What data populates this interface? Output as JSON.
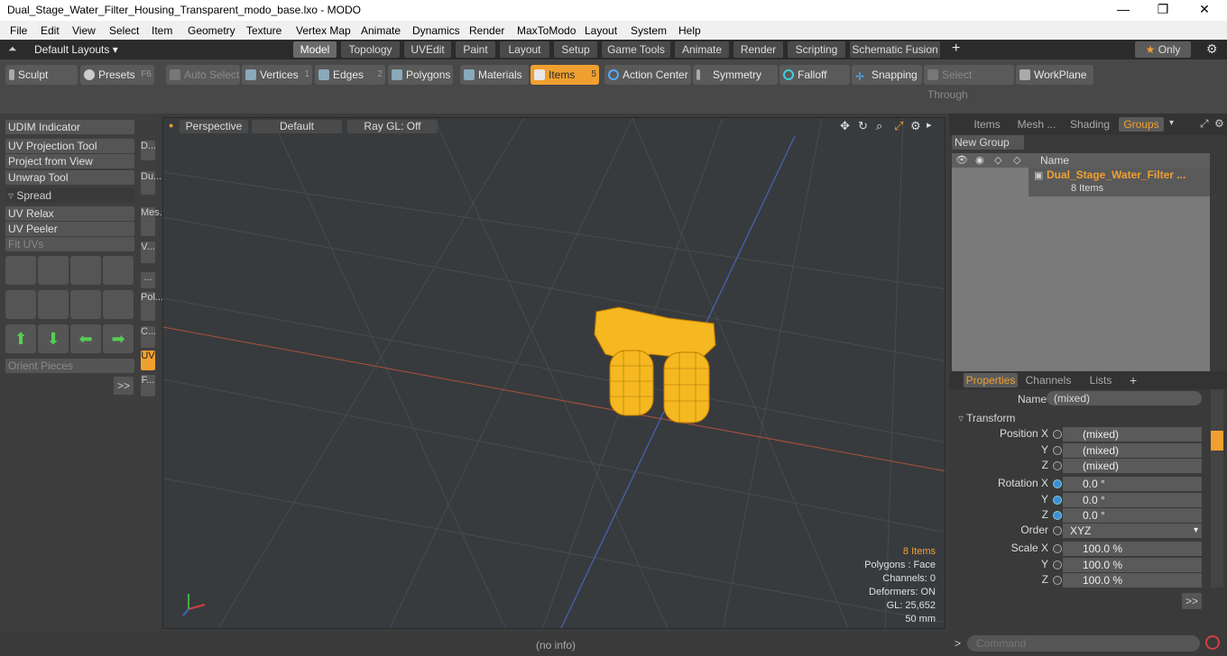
{
  "window": {
    "title": "Dual_Stage_Water_Filter_Housing_Transparent_modo_base.lxo - MODO"
  },
  "menu": [
    "File",
    "Edit",
    "View",
    "Select",
    "Item",
    "Geometry",
    "Texture",
    "Vertex Map",
    "Animate",
    "Dynamics",
    "Render",
    "MaxToModo",
    "Layout",
    "System",
    "Help"
  ],
  "layouts": {
    "label": "Default Layouts ▾"
  },
  "tabs": [
    "Model",
    "Topology",
    "UVEdit",
    "Paint",
    "Layout",
    "Setup",
    "Game Tools",
    "Animate",
    "Render",
    "Scripting",
    "Schematic Fusion"
  ],
  "only": "Only",
  "toolbar": {
    "sculpt": "Sculpt",
    "presets": "Presets",
    "presets_key": "F6",
    "auto_select": "Auto Select",
    "vertices": "Vertices",
    "vertices_n": "1",
    "edges": "Edges",
    "edges_n": "2",
    "polygons": "Polygons",
    "materials": "Materials",
    "items": "Items",
    "items_n": "5",
    "action_center": "Action Center",
    "symmetry": "Symmetry",
    "falloff": "Falloff",
    "snapping": "Snapping",
    "select_through": "Select Through",
    "workplane": "WorkPlane"
  },
  "left": {
    "udim": "UDIM Indicator",
    "uv_projection": "UV Projection Tool",
    "project_view": "Project from View",
    "unwrap": "Unwrap Tool",
    "spread": "Spread",
    "uv_relax": "UV Relax",
    "uv_peeler": "UV Peeler",
    "fit_uvs": "Fit UVs",
    "orient": "Orient Pieces",
    "more": ">>",
    "vtabs": [
      "D...",
      "Du...",
      "Mes...",
      "V...",
      "...",
      "Pol...",
      "C...",
      "UV",
      "F..."
    ]
  },
  "viewport": {
    "perspective": "Perspective",
    "default": "Default",
    "raygl": "Ray GL: Off",
    "info": {
      "items": "8 Items",
      "polygons": "Polygons : Face",
      "channels": "Channels: 0",
      "deformers": "Deformers: ON",
      "gl": "GL: 25,652",
      "size": "50 mm"
    }
  },
  "right": {
    "tabs": [
      "Items",
      "Mesh ...",
      "Shading",
      "Groups"
    ],
    "new_group": "New Group",
    "col_name": "Name",
    "group_name": "Dual_Stage_Water_Filter ...",
    "group_count": "8 Items",
    "ptabs": [
      "Properties",
      "Channels",
      "Lists"
    ],
    "name_label": "Name",
    "name_value": "(mixed)",
    "transform": "Transform",
    "pos_x_label": "Position X",
    "pos_x": "(mixed)",
    "pos_y_label": "Y",
    "pos_y": "(mixed)",
    "pos_z_label": "Z",
    "pos_z": "(mixed)",
    "rot_x_label": "Rotation X",
    "rot_x": "0.0 °",
    "rot_y_label": "Y",
    "rot_y": "0.0 °",
    "rot_z_label": "Z",
    "rot_z": "0.0 °",
    "order_label": "Order",
    "order": "XYZ",
    "scale_x_label": "Scale X",
    "scale_x": "100.0 %",
    "scale_y_label": "Y",
    "scale_y": "100.0 %",
    "scale_z_label": "Z",
    "scale_z": "100.0 %",
    "more": ">>"
  },
  "status": {
    "info": "(no info)",
    "command_placeholder": "Command"
  },
  "colors": {
    "accent": "#f0a030",
    "model_wire": "#f5b820"
  }
}
